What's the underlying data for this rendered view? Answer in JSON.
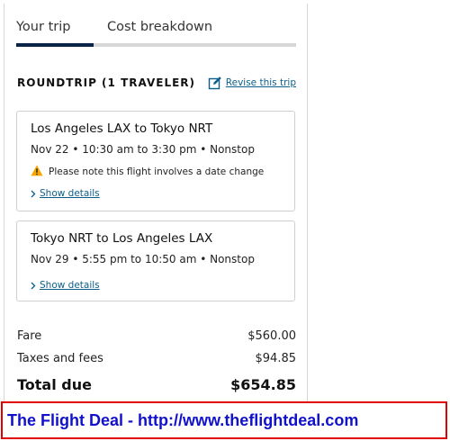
{
  "tabs": {
    "your_trip": "Your trip",
    "cost_breakdown": "Cost breakdown"
  },
  "trip": {
    "title": "ROUNDTRIP (1 TRAVELER)",
    "revise_label": "Revise this trip"
  },
  "flights": [
    {
      "route": "Los Angeles LAX to Tokyo NRT",
      "schedule": "Nov 22 • 10:30 am to 3:30 pm • Nonstop",
      "warning": "Please note this flight involves a date change",
      "details_label": "Show details"
    },
    {
      "route": "Tokyo NRT to Los Angeles LAX",
      "schedule": "Nov 29 • 5:55 pm to 10:50 am • Nonstop",
      "details_label": "Show details"
    }
  ],
  "costs": {
    "fare_label": "Fare",
    "fare_value": "$560.00",
    "taxes_label": "Taxes and fees",
    "taxes_value": "$94.85",
    "total_label": "Total due",
    "total_value": "$654.85"
  },
  "banner": {
    "text": "The Flight Deal - http://www.theflightdeal.com"
  },
  "colors": {
    "accent_navy": "#0b2346",
    "link_blue": "#0c5e8a",
    "warning_yellow": "#f4a800",
    "banner_border": "#e00000",
    "banner_text": "#1111cc"
  },
  "icons": {
    "revise": "edit-icon",
    "warning": "warning-icon",
    "details": "chevron-right-icon"
  }
}
